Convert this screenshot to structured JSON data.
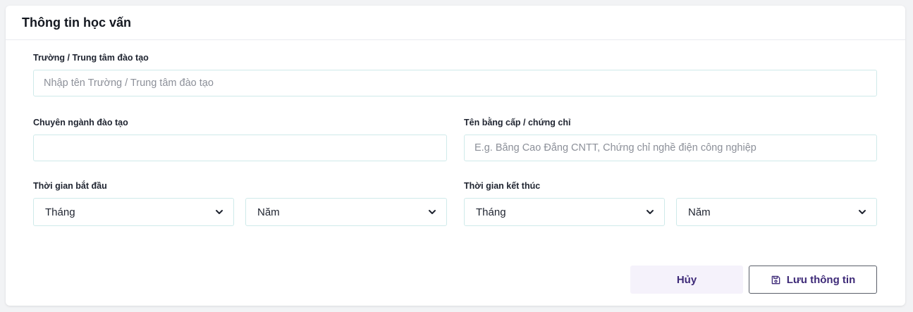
{
  "section": {
    "title": "Thông tin học vấn"
  },
  "school": {
    "label": "Trường / Trung tâm đào tạo",
    "placeholder": "Nhập tên Trường / Trung tâm đào tạo",
    "value": ""
  },
  "major": {
    "label": "Chuyên ngành đào tạo",
    "placeholder": "",
    "value": ""
  },
  "degree": {
    "label": "Tên bằng cấp / chứng chỉ",
    "placeholder": "E.g. Bằng Cao Đẳng CNTT, Chứng chỉ nghề điện công nghiệp",
    "value": ""
  },
  "start": {
    "label": "Thời gian bắt đầu",
    "month": "Tháng",
    "year": "Năm"
  },
  "end": {
    "label": "Thời gian kết thúc",
    "month": "Tháng",
    "year": "Năm"
  },
  "actions": {
    "cancel": "Hủy",
    "save": "Lưu thông tin",
    "save_icon": "save-icon",
    "dropdown_icon": "chevron-down-icon"
  },
  "colors": {
    "accent": "#3e2a78",
    "input_border": "#cfeaea",
    "cancel_bg": "#f5f2fb"
  }
}
